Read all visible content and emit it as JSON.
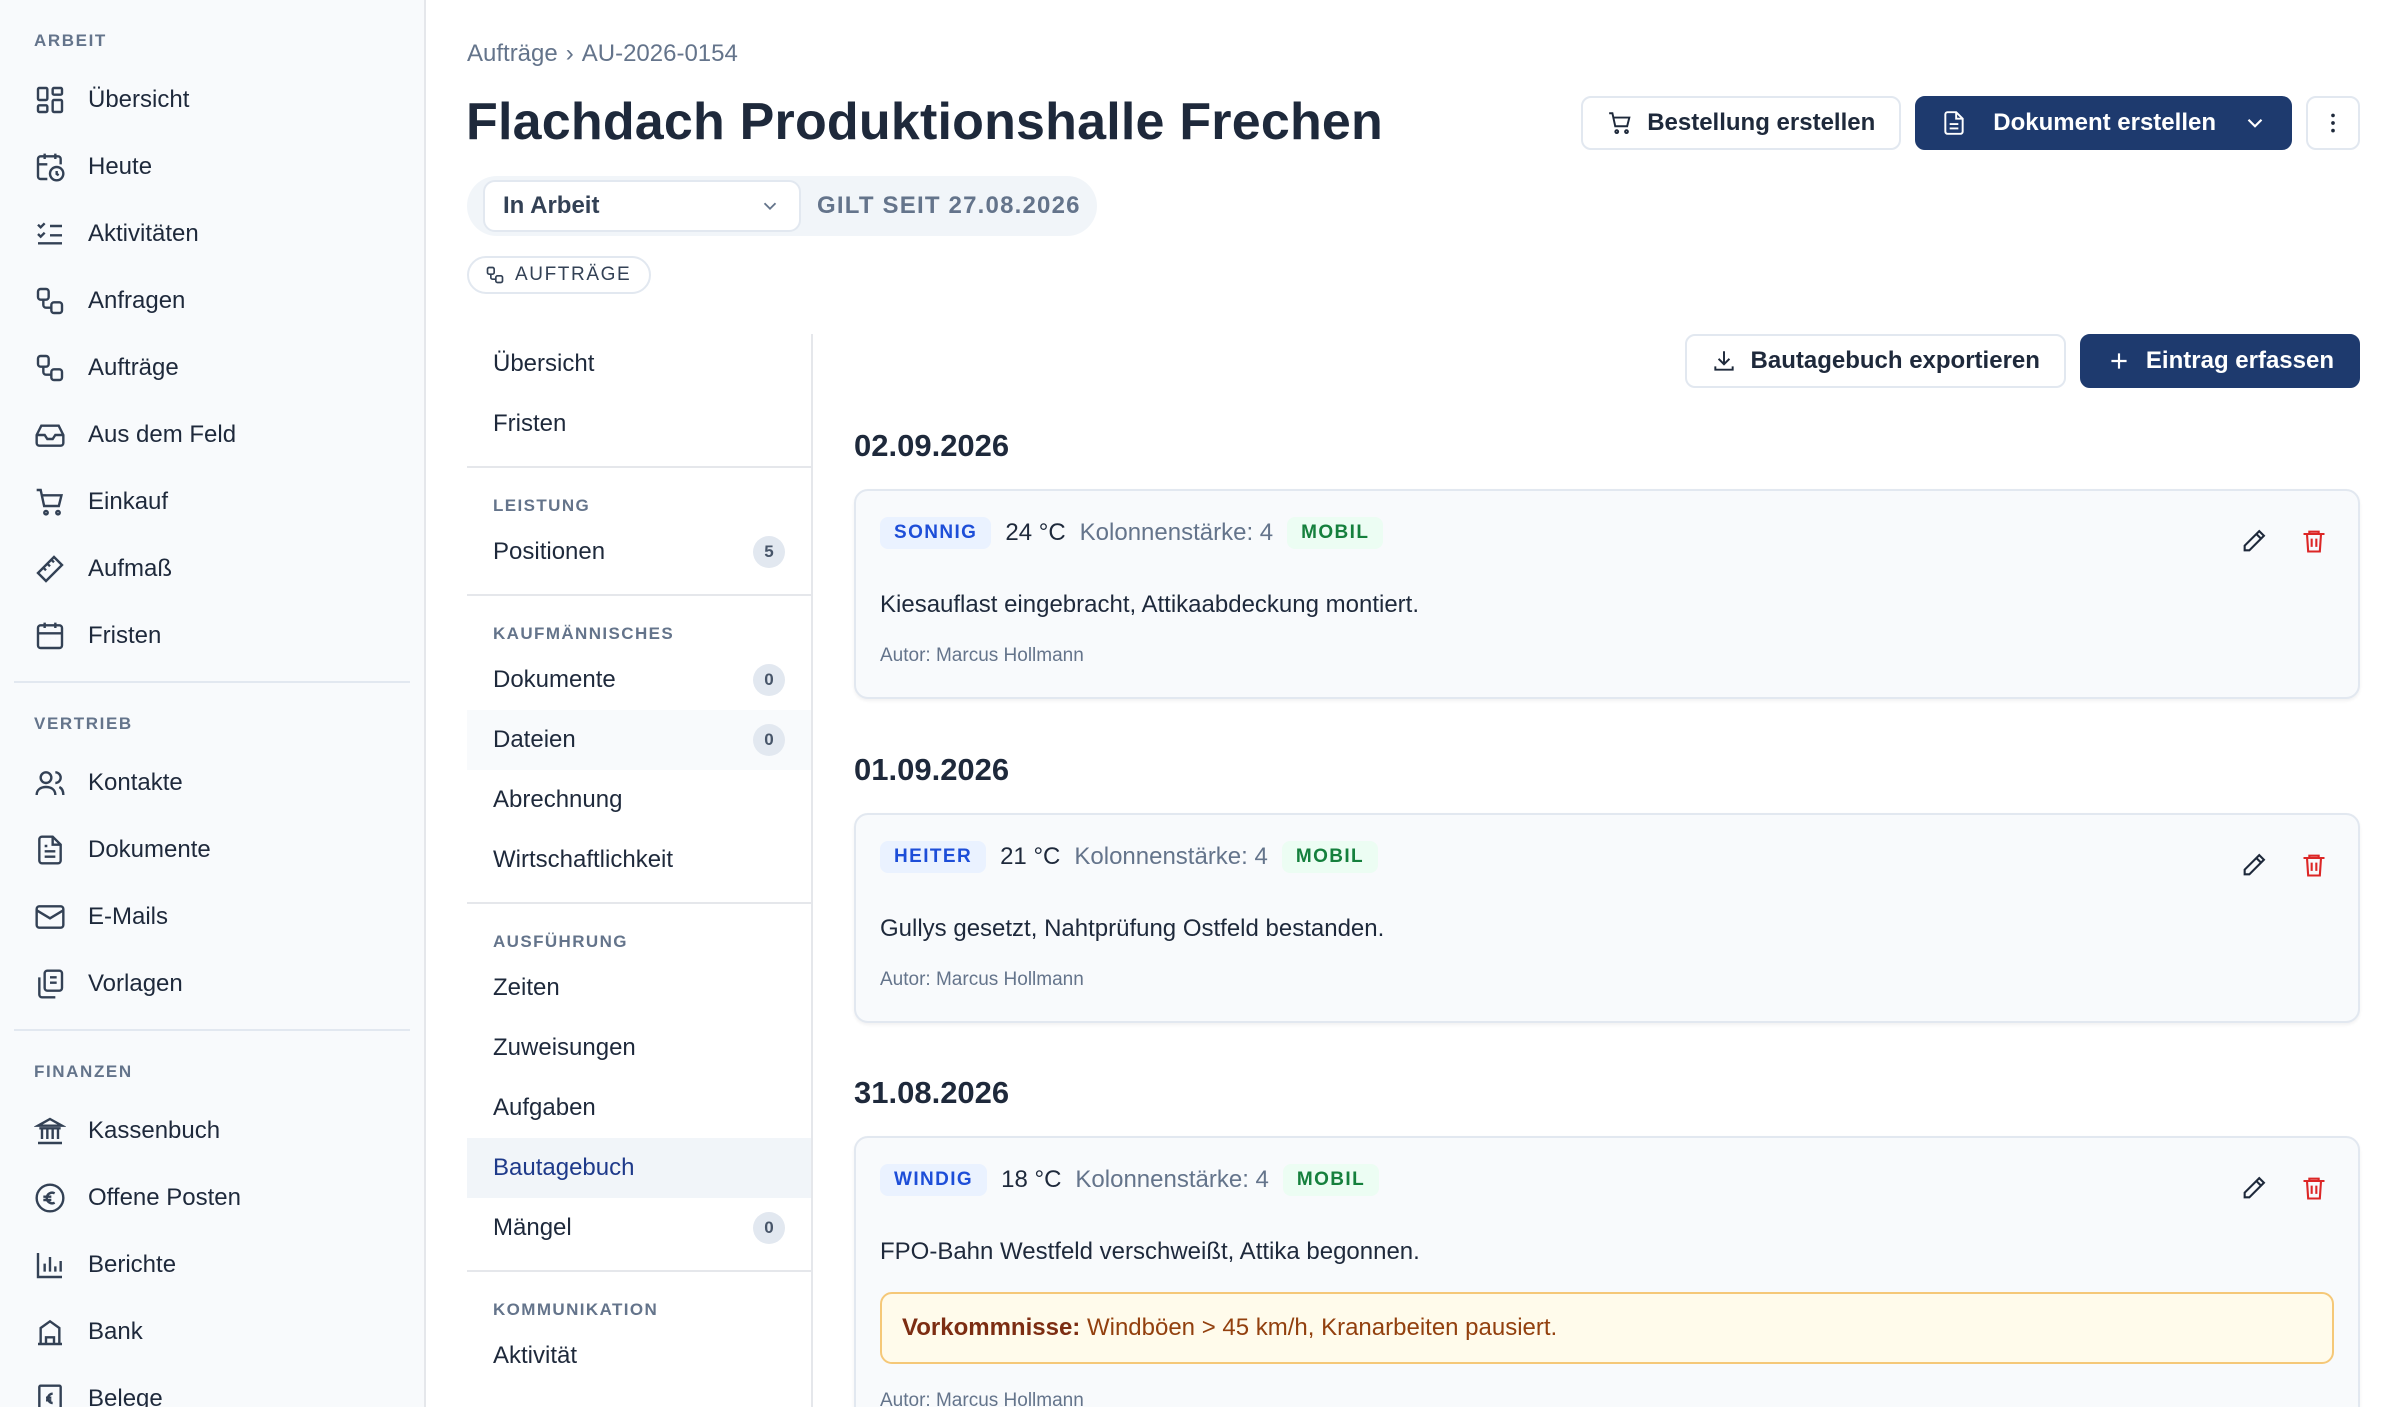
{
  "sidebar": {
    "groups": [
      {
        "label": "ARBEIT",
        "items": [
          {
            "label": "Übersicht",
            "icon": "dashboard-icon"
          },
          {
            "label": "Heute",
            "icon": "calendar-clock-icon"
          },
          {
            "label": "Aktivitäten",
            "icon": "checklist-icon"
          },
          {
            "label": "Anfragen",
            "icon": "workflow-icon"
          },
          {
            "label": "Aufträge",
            "icon": "workflow-icon"
          },
          {
            "label": "Aus dem Feld",
            "icon": "inbox-icon"
          },
          {
            "label": "Einkauf",
            "icon": "cart-icon"
          },
          {
            "label": "Aufmaß",
            "icon": "ruler-icon"
          },
          {
            "label": "Fristen",
            "icon": "calendar-icon"
          }
        ]
      },
      {
        "label": "VERTRIEB",
        "items": [
          {
            "label": "Kontakte",
            "icon": "users-icon"
          },
          {
            "label": "Dokumente",
            "icon": "document-icon"
          },
          {
            "label": "E-Mails",
            "icon": "mail-icon"
          },
          {
            "label": "Vorlagen",
            "icon": "copy-icon"
          }
        ]
      },
      {
        "label": "FINANZEN",
        "items": [
          {
            "label": "Kassenbuch",
            "icon": "bank-icon"
          },
          {
            "label": "Offene Posten",
            "icon": "euro-icon"
          },
          {
            "label": "Berichte",
            "icon": "bar-chart-icon"
          },
          {
            "label": "Bank",
            "icon": "building-icon"
          },
          {
            "label": "Belege",
            "icon": "receipt-icon"
          }
        ]
      }
    ]
  },
  "header": {
    "breadcrumb": [
      "Aufträge",
      "›",
      "AU-2026-0154"
    ],
    "title": "Flachdach Produktionshalle Frechen",
    "status": "In Arbeit",
    "since": "GILT SEIT 27.08.2026",
    "tag": "AUFTRÄGE",
    "order_button": "Bestellung erstellen",
    "document_button": "Dokument erstellen"
  },
  "subnav": {
    "top": [
      {
        "label": "Übersicht"
      },
      {
        "label": "Fristen"
      }
    ],
    "sections": [
      {
        "label": "LEISTUNG",
        "items": [
          {
            "label": "Positionen",
            "count": "5"
          }
        ]
      },
      {
        "label": "KAUFMÄNNISCHES",
        "items": [
          {
            "label": "Dokumente",
            "count": "0"
          },
          {
            "label": "Dateien",
            "count": "0"
          },
          {
            "label": "Abrechnung"
          },
          {
            "label": "Wirtschaftlichkeit"
          }
        ]
      },
      {
        "label": "AUSFÜHRUNG",
        "items": [
          {
            "label": "Zeiten"
          },
          {
            "label": "Zuweisungen"
          },
          {
            "label": "Aufgaben"
          },
          {
            "label": "Bautagebuch"
          },
          {
            "label": "Mängel",
            "count": "0"
          }
        ]
      },
      {
        "label": "KOMMUNIKATION",
        "items": [
          {
            "label": "Aktivität"
          }
        ]
      }
    ]
  },
  "content": {
    "export_button": "Bautagebuch exportieren",
    "add_button": "Eintrag erfassen",
    "entries": [
      {
        "date": "02.09.2026",
        "weather": "SONNIG",
        "temp": "24 °C",
        "crew": "Kolonnenstärke: 4",
        "source": "MOBIL",
        "text": "Kiesauflast eingebracht, Attikaabdeckung montiert.",
        "author": "Autor: Marcus Hollmann"
      },
      {
        "date": "01.09.2026",
        "weather": "HEITER",
        "temp": "21 °C",
        "crew": "Kolonnenstärke: 4",
        "source": "MOBIL",
        "text": "Gullys gesetzt, Nahtprüfung Ostfeld bestanden.",
        "author": "Autor: Marcus Hollmann"
      },
      {
        "date": "31.08.2026",
        "weather": "WINDIG",
        "temp": "18 °C",
        "crew": "Kolonnenstärke: 4",
        "source": "MOBIL",
        "text": "FPO-Bahn Westfeld verschweißt, Attika begonnen.",
        "incident_label": "Vorkommnisse:",
        "incident_text": "Windböen > 45 km/h, Kranarbeiten pausiert.",
        "author": "Autor: Marcus Hollmann"
      }
    ]
  },
  "colors": {
    "primary": "#1e3a6e",
    "weather_badge": "#1d4ed8",
    "mobil_badge": "#15803d",
    "delete": "#dc2626",
    "incident_border": "#f5c878"
  }
}
